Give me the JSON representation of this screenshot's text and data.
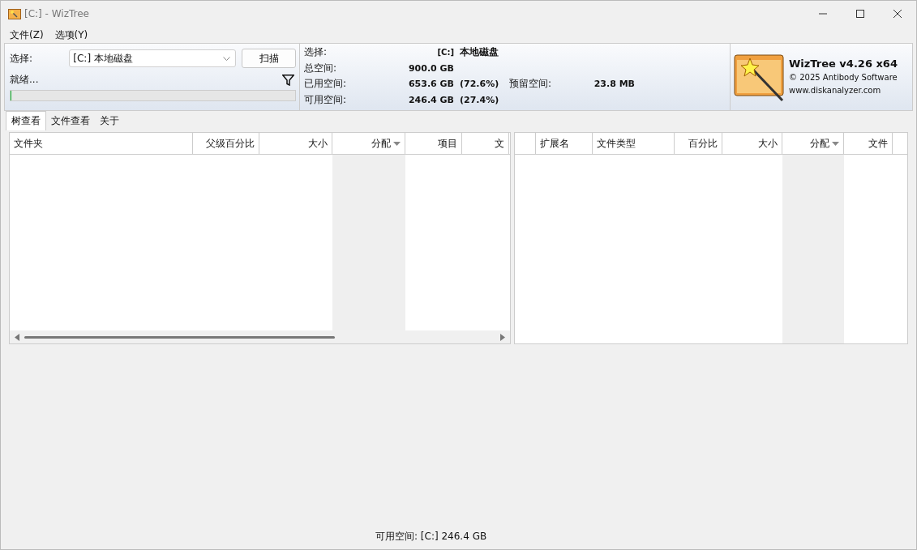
{
  "window": {
    "title": "[C:]  - WizTree"
  },
  "menu": [
    "文件(Z)",
    "选项(Y)"
  ],
  "scan_panel": {
    "select_label": "选择:",
    "drive_value": "[C:] 本地磁盘",
    "scan_button": "扫描",
    "status": "就绪...",
    "progress": {
      "level": 0
    }
  },
  "drive_info": {
    "rows": [
      {
        "label": "选择:",
        "value": "[C:]",
        "extra": "本地磁盘",
        "kind": "drive"
      },
      {
        "label": "总空间:",
        "value": "900.0 GB",
        "kind": "size"
      },
      {
        "label": "已用空间:",
        "value": "653.6 GB",
        "extra": "(72.6%)",
        "reserved_label": "预留空间:",
        "reserved_value": "23.8 MB",
        "kind": "size"
      },
      {
        "label": "可用空间:",
        "value": "246.4 GB",
        "extra": "(27.4%)",
        "kind": "size"
      }
    ]
  },
  "about": {
    "title": "WizTree v4.26 x64",
    "copyright": "© 2025 Antibody Software",
    "website": "www.diskanalyzer.com"
  },
  "tabs": [
    {
      "label": "树查看",
      "selected": true
    },
    {
      "label": "文件查看",
      "selected": false
    },
    {
      "label": "关于",
      "selected": false
    }
  ],
  "folder_table": {
    "columns": [
      {
        "label": "文件夹",
        "sorted": false
      },
      {
        "label": "父级百分比",
        "sorted": false
      },
      {
        "label": "大小",
        "sorted": false
      },
      {
        "label": "分配",
        "sorted": true
      },
      {
        "label": "项目",
        "sorted": false
      },
      {
        "label": "文",
        "sorted": false
      }
    ]
  },
  "extension_table": {
    "columns": [
      {
        "sorted": false
      },
      {
        "label": "扩展名",
        "sorted": false
      },
      {
        "label": "文件类型",
        "sorted": false
      },
      {
        "label": "百分比",
        "sorted": false
      },
      {
        "label": "大小",
        "sorted": false
      },
      {
        "label": "分配",
        "sorted": true
      },
      {
        "label": "文件",
        "sorted": false
      }
    ]
  },
  "status_bar": "可用空间: [C:] 246.4 GB"
}
